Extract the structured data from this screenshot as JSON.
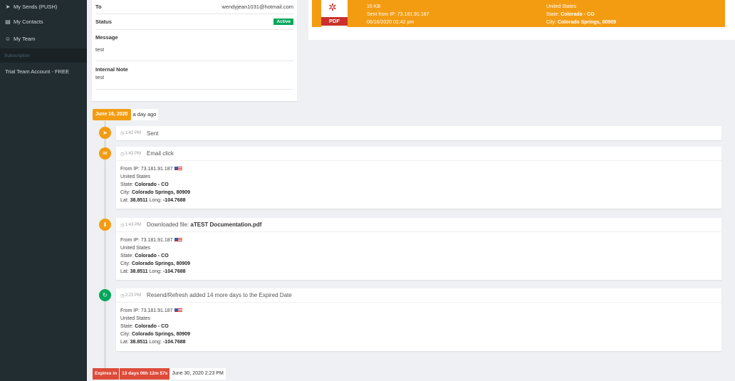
{
  "sidebar": {
    "items": [
      {
        "label": "My Sends (PUSH)",
        "icon": "send-icon"
      },
      {
        "label": "My Contacts",
        "icon": "address-book-icon"
      },
      {
        "label": "My Team",
        "icon": "users-icon"
      }
    ],
    "section_header": "Subscription",
    "plan_label": "Trial Team Account - FREE"
  },
  "info": {
    "to_label": "To",
    "to_value": "wendyjean1031@hotmail.com",
    "status_label": "Status",
    "status_value": "Active",
    "message_label": "Message",
    "message_value": "test",
    "note_label": "Internal Note",
    "note_value": "test"
  },
  "file_card": {
    "pdf_label": "PDF",
    "size": "15 KB",
    "sent_from": "Sent from IP: 73.181.91.187",
    "datetime": "06/16/2020 01:42 pm",
    "country": "United States",
    "state_label": "State: ",
    "state_value": "Colorado - CO",
    "city_label": "City: ",
    "city_value": "Colorado Springs, 80909"
  },
  "timeline": {
    "date": "June 16, 2020",
    "ago": "a day ago",
    "events": [
      {
        "time": "1:42 PM",
        "title": "Sent",
        "icon": "paper-plane-icon"
      },
      {
        "time": "1:43 PM",
        "title": "Email click",
        "icon": "envelope-icon",
        "ip": "From IP: 73.181.91.187",
        "country": "United States",
        "state": "Colorado - CO",
        "city": "Colorado Springs, 80909",
        "lat": "38.8511",
        "long": "-104.7688"
      },
      {
        "time": "1:43 PM",
        "title_prefix": "Downloaded file: ",
        "title_file": "aTEST Documentation.pdf",
        "icon": "download-icon",
        "ip": "From IP: 73.181.91.187",
        "country": "United States",
        "state": "Colorado - CO",
        "city": "Colorado Springs, 80909",
        "lat": "38.8511",
        "long": "-104.7688"
      },
      {
        "time": "2:23 PM",
        "title": "Resend/Refresh added 14 more days to the Expired Date",
        "icon": "refresh-icon",
        "ip": "From IP: 73.181.91.187",
        "country": "United States",
        "state": "Colorado - CO",
        "city": "Colorado Springs, 80909",
        "lat": "38.8511",
        "long": "-104.7688"
      }
    ],
    "labels": {
      "state": "State: ",
      "city": "City: ",
      "lat": "Lat: ",
      "long": " Long: "
    }
  },
  "expires": {
    "label": "Expires in",
    "countdown": "13 days 06h 12m 57s",
    "date": "June 30, 2020 2:23 PM"
  },
  "colors": {
    "orange": "#f39c12",
    "green": "#00a65a",
    "red": "#dd4b39",
    "sidebar": "#222d32"
  }
}
